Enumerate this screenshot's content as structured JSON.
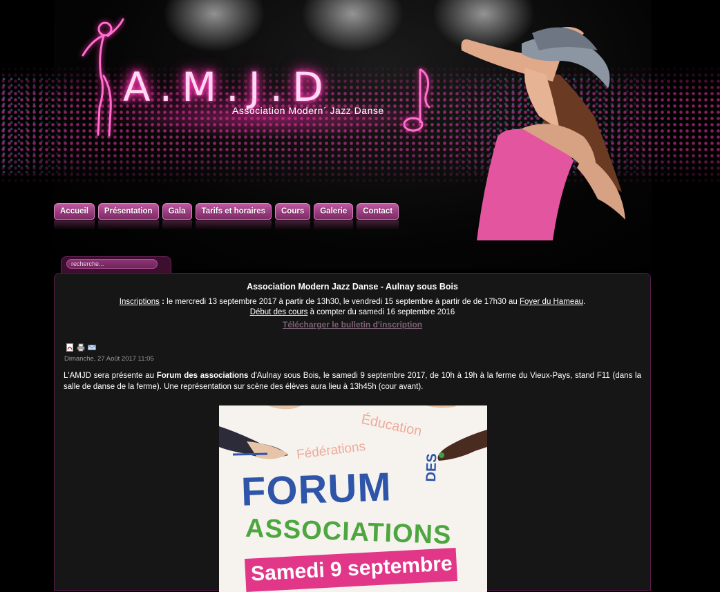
{
  "header": {
    "logo_text": "A.M.J.D",
    "logo_subtitle": "Association Modern´ Jazz Danse"
  },
  "nav": {
    "items": [
      {
        "label": "Accueil"
      },
      {
        "label": "Présentation"
      },
      {
        "label": "Gala"
      },
      {
        "label": "Tarifs et horaires"
      },
      {
        "label": "Cours"
      },
      {
        "label": "Galerie"
      },
      {
        "label": "Contact"
      }
    ]
  },
  "search": {
    "placeholder": "recherche..."
  },
  "content": {
    "title": "Association Modern Jazz Danse - Aulnay sous Bois",
    "info": {
      "inscriptions_label": "Inscriptions",
      "inscriptions_sep": " : ",
      "inscriptions_text": "le mercredi 13 septembre 2017 à partir de 13h30, le vendredi 15 septembre à partir de de 17h30 au ",
      "inscriptions_place": "Foyer du Hameau",
      "inscriptions_end": ".",
      "debut_label": "Début des cours",
      "debut_text": " à compter du samedi 16 septembre 2016"
    },
    "download_label": "Télécharger le bulletin d'inscription",
    "article": {
      "date": "Dimanche, 27 Août 2017 11:05",
      "text_intro": "L'AMJD sera présente au ",
      "text_bold": "Forum des associations",
      "text_rest": " d'Aulnay sous Bois, le samedi 9 septembre 2017, de 10h à 19h à la ferme du Vieux-Pays, stand F11 (dans la salle de danse de la ferme). Une représentation sur scène des élèves aura lieu à 13h45h (cour avant).",
      "tools": [
        "pdf-icon",
        "print-icon",
        "email-icon"
      ]
    },
    "poster": {
      "word_education": "Éducation",
      "word_federations": "Fédérations",
      "word_forum": "FORUM",
      "word_des": "DES",
      "word_associations": "ASSOCIATIONS",
      "word_date": "Samedi 9 septembre"
    }
  },
  "colors": {
    "nav_button": "#9a3c80",
    "neon_pink": "#ff2fa8",
    "content_bg": "#161616",
    "poster_blue": "#2f55a8",
    "poster_green": "#4da63f",
    "poster_pink": "#e23789"
  }
}
